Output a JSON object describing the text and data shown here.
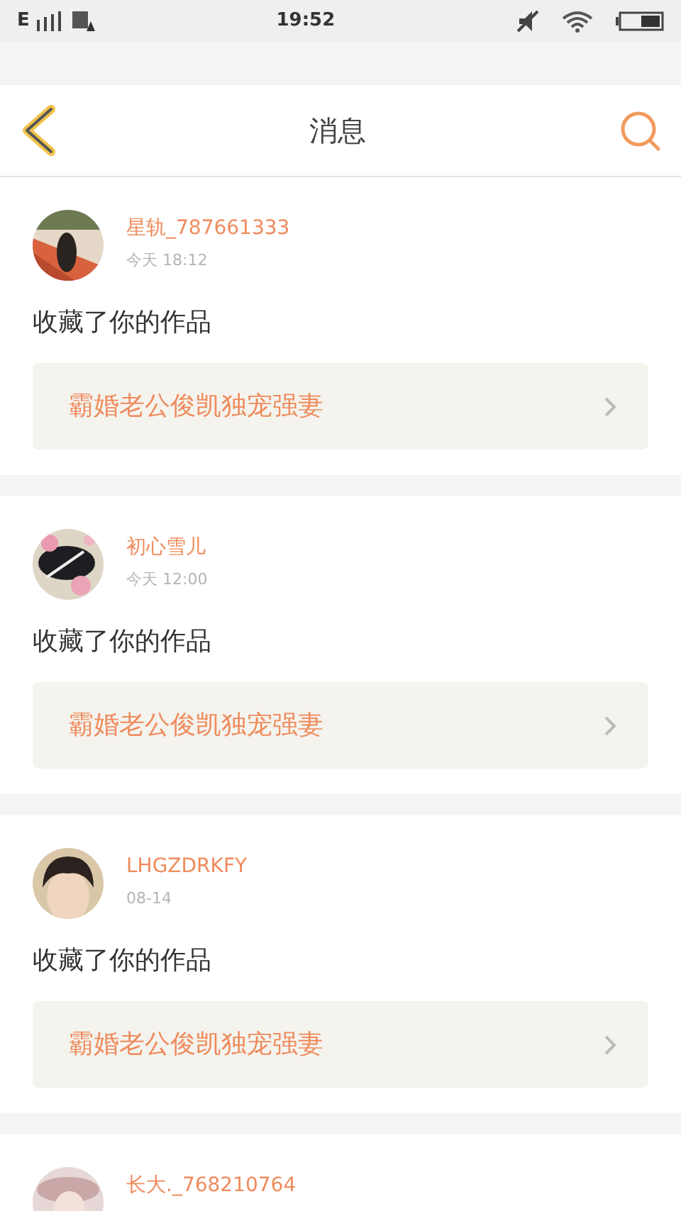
{
  "status_bar": {
    "network": "E",
    "time": "19:52"
  },
  "header": {
    "title": "消息"
  },
  "messages": [
    {
      "name": "星轨_787661333",
      "time": "今天 18:12",
      "text": "收藏了你的作品",
      "work_title": "霸婚老公俊凯独宠强妻"
    },
    {
      "name": "初心雪儿",
      "time": "今天 12:00",
      "text": "收藏了你的作品",
      "work_title": "霸婚老公俊凯独宠强妻"
    },
    {
      "name": "LHGZDRKFY",
      "time": "08-14",
      "text": "收藏了你的作品",
      "work_title": "霸婚老公俊凯独宠强妻"
    },
    {
      "name": "长大._768210764"
    }
  ]
}
